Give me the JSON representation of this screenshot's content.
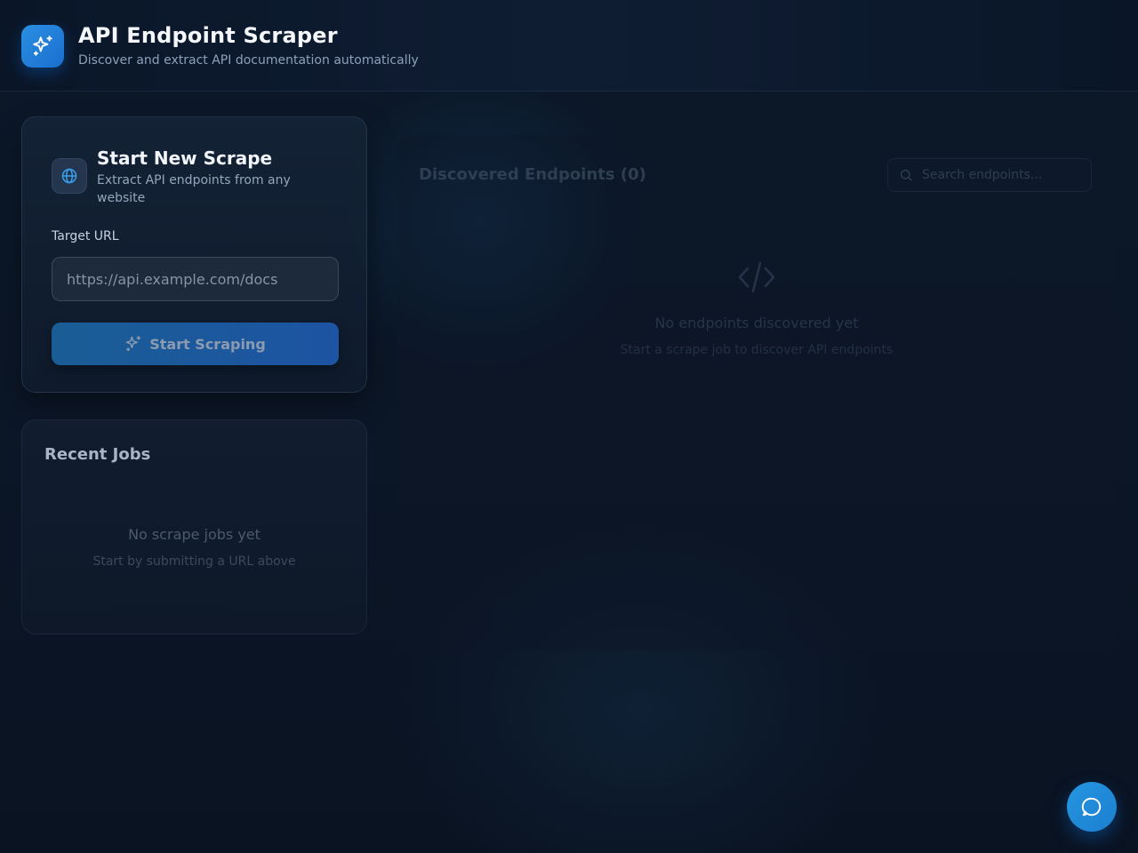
{
  "header": {
    "title": "API Endpoint Scraper",
    "subtitle": "Discover and extract API documentation automatically",
    "logo_icon": "sparkles-icon"
  },
  "scrape_card": {
    "icon": "globe-icon",
    "title": "Start New Scrape",
    "description": "Extract API endpoints from any website",
    "url_label": "Target URL",
    "url_value": "",
    "url_placeholder": "https://api.example.com/docs",
    "button_label": "Start Scraping",
    "button_icon": "sparkles-icon"
  },
  "jobs_card": {
    "title": "Recent Jobs",
    "empty_title": "No scrape jobs yet",
    "empty_subtitle": "Start by submitting a URL above"
  },
  "endpoints_panel": {
    "title": "Discovered Endpoints (0)",
    "search_placeholder": "Search endpoints...",
    "search_value": "",
    "empty_icon": "code-icon",
    "empty_title": "No endpoints discovered yet",
    "empty_subtitle": "Start a scrape job to discover API endpoints"
  },
  "chat_button": {
    "icon": "chat-bubble-icon"
  },
  "colors": {
    "accent": "#1f8fe0",
    "background": "#0b1626",
    "button_gradient_start": "#1a5d95",
    "button_gradient_end": "#1d54a3"
  }
}
